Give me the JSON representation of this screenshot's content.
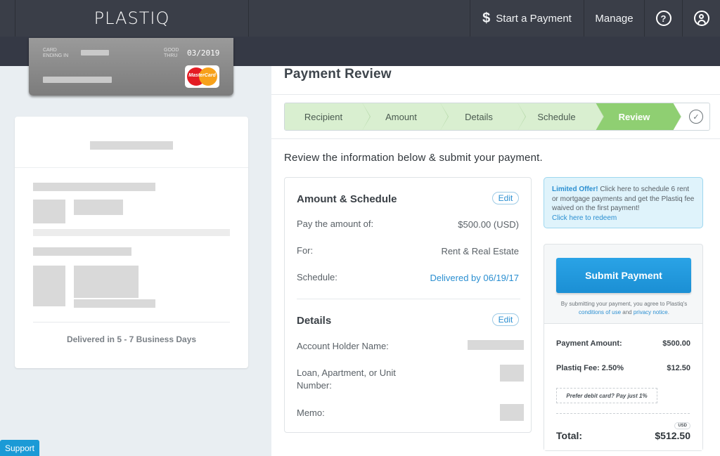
{
  "header": {
    "logo": "PLASTIQ",
    "nav": {
      "start_payment_icon": "$",
      "start_payment": "Start a Payment",
      "manage": "Manage",
      "help_icon": "?"
    }
  },
  "card": {
    "card_label_line1": "CARD",
    "card_label_line2": "ENDING IN",
    "good_label_line1": "GOOD",
    "good_label_line2": "THRU",
    "expiry": "03/2019",
    "brand": "MasterCard",
    "brand_icon": "mastercard-logo"
  },
  "recipient": {
    "delivery_note": "Delivered in 5 - 7 Business Days"
  },
  "support": {
    "label": "Support"
  },
  "main": {
    "title": "Payment Review",
    "steps": [
      {
        "label": "Recipient"
      },
      {
        "label": "Amount"
      },
      {
        "label": "Details"
      },
      {
        "label": "Schedule"
      },
      {
        "label": "Review",
        "active": true
      }
    ],
    "done_icon": "✓",
    "instruction": "Review the information below & submit your payment.",
    "amount_schedule": {
      "title": "Amount & Schedule",
      "edit": "Edit",
      "pay_label": "Pay the amount of:",
      "pay_value": "$500.00 (USD)",
      "for_label": "For:",
      "for_value": "Rent & Real Estate",
      "schedule_label": "Schedule:",
      "schedule_value": "Delivered by 06/19/17"
    },
    "details": {
      "title": "Details",
      "edit": "Edit",
      "holder_label": "Account Holder Name:",
      "loan_label_line1": "Loan, Apartment, or Unit",
      "loan_label_line2": "Number:",
      "memo_label": "Memo:"
    }
  },
  "offer": {
    "bold": "Limited Offer!",
    "text": " Click here to schedule 6 rent or mortgage payments and get the Plastiq fee waived on the first payment!",
    "link": "Click here to redeem"
  },
  "payment": {
    "submit": "Submit Payment",
    "agree_prefix": "By submitting your payment, you agree to Plastiq's ",
    "conditions": "conditions of use",
    "and": " and ",
    "privacy": "privacy notice",
    "period": ".",
    "amount_label": "Payment Amount:",
    "amount_value": "$500.00",
    "fee_label": "Plastiq Fee: 2.50%",
    "fee_value": "$12.50",
    "debit_note": "Prefer debit card? Pay just 1%",
    "currency": "USD",
    "total_label": "Total:",
    "total_value": "$512.50"
  },
  "colors": {
    "nav_bg": "#3a3e48",
    "step_done": "#d9efd0",
    "step_active": "#8fcf72",
    "accent_blue": "#2b8fd1",
    "submit_blue": "#1b8fd4"
  }
}
